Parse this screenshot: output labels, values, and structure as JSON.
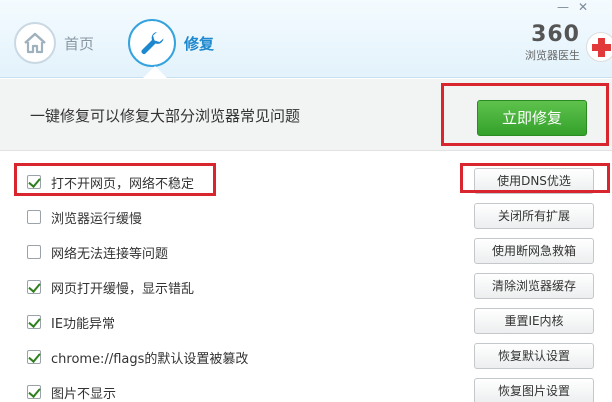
{
  "window": {
    "minimize": "—",
    "close": "✕"
  },
  "nav": {
    "home_label": "首页",
    "repair_label": "修复"
  },
  "brand": {
    "number": "360",
    "name": "浏览器医生"
  },
  "banner": {
    "description": "一键修复可以修复大部分浏览器常见问题",
    "fix_button": "立即修复"
  },
  "issues": [
    {
      "label": "打不开网页，网络不稳定",
      "checked": true,
      "action": "使用DNS优选"
    },
    {
      "label": "浏览器运行缓慢",
      "checked": false,
      "action": "关闭所有扩展"
    },
    {
      "label": "网络无法连接等问题",
      "checked": false,
      "action": "使用断网急救箱"
    },
    {
      "label": "网页打开缓慢，显示错乱",
      "checked": true,
      "action": "清除浏览器缓存"
    },
    {
      "label": "IE功能异常",
      "checked": true,
      "action": "重置IE内核"
    },
    {
      "label": "chrome://flags的默认设置被篡改",
      "checked": true,
      "action": "恢复默认设置"
    },
    {
      "label": "图片不显示",
      "checked": true,
      "action": "恢复图片设置"
    }
  ],
  "colors": {
    "accent": "#1e88cf",
    "fix_green": "#3aa82f",
    "annotation_red": "#d9262e"
  }
}
